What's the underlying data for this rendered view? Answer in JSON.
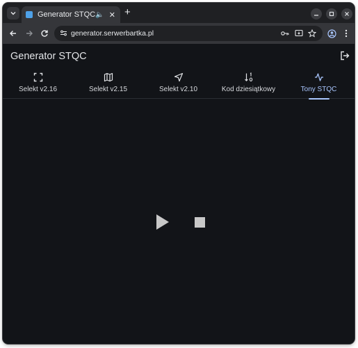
{
  "browser": {
    "tab_title": "Generator STQC",
    "url": "generator.serwerbartka.pl"
  },
  "app": {
    "title": "Generator STQC",
    "tabs": [
      {
        "label": "Selekt v2.16",
        "icon": "fullscreen-icon"
      },
      {
        "label": "Selekt v2.15",
        "icon": "map-icon"
      },
      {
        "label": "Selekt v2.10",
        "icon": "navigation-icon"
      },
      {
        "label": "Kod dziesiątkowy",
        "icon": "sort-numeric-icon"
      },
      {
        "label": "Tony STQC",
        "icon": "activity-icon"
      }
    ],
    "active_tab": "Tony STQC"
  },
  "colors": {
    "app_background": "#121418",
    "accent": "#aac7ff",
    "text": "#e3e5e8"
  }
}
